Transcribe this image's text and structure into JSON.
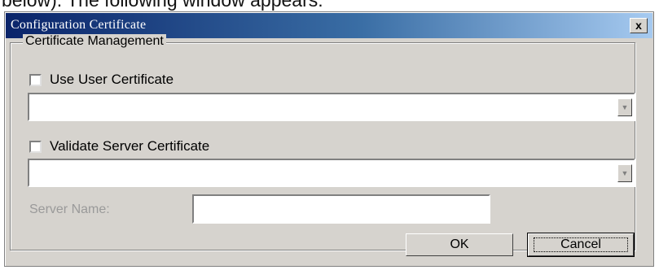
{
  "caption": "below). The following window appears:",
  "window": {
    "title": "Configuration Certificate",
    "close_glyph": "x"
  },
  "group": {
    "legend": "Certificate Management"
  },
  "user_cert": {
    "checkbox_label": "Use User Certificate",
    "checked": false,
    "combo_value": ""
  },
  "server_cert": {
    "checkbox_label": "Validate Server Certificate",
    "checked": false,
    "combo_value": ""
  },
  "server_name": {
    "label": "Server Name:",
    "value": ""
  },
  "buttons": {
    "ok": "OK",
    "cancel": "Cancel"
  },
  "icons": {
    "combo_arrow": "chevron-down-icon"
  }
}
